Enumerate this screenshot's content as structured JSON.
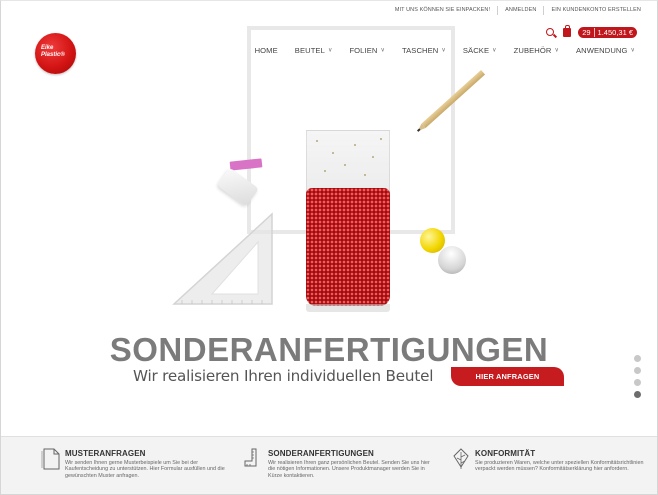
{
  "topbar": {
    "links": [
      "MIT UNS KÖNNEN SIE EINPACKEN!",
      "ANMELDEN",
      "EIN KUNDENKONTO ERSTELLEN"
    ]
  },
  "logo": {
    "text_line1": "Eike",
    "text_line2": "Plastic®",
    "icon": "logo-icon"
  },
  "cart": {
    "count": "29",
    "total": "1.450,31 €",
    "search_icon": "search-icon",
    "bag_icon": "shopping-bag-icon"
  },
  "nav": {
    "items": [
      {
        "label": "HOME",
        "dropdown": false
      },
      {
        "label": "BEUTEL",
        "dropdown": true
      },
      {
        "label": "FOLIEN",
        "dropdown": true
      },
      {
        "label": "TASCHEN",
        "dropdown": true
      },
      {
        "label": "SÄCKE",
        "dropdown": true
      },
      {
        "label": "ZUBEHÖR",
        "dropdown": true
      },
      {
        "label": "ANWENDUNG",
        "dropdown": true
      }
    ]
  },
  "hero": {
    "headline": "SONDERANFERTIGUNGEN",
    "subline": "Wir realisieren Ihren individuellen Beutel",
    "cta": "HIER ANFRAGEN",
    "slides": 4,
    "active_slide": 4
  },
  "features": [
    {
      "icon": "document-icon",
      "title": "MUSTERANFRAGEN",
      "text": "Wir senden Ihnen gerne Musterbeispiele um Sie bei der Kaufentscheidung zu unterstützen. Hier Formular ausfüllen und die gewünschten Muster anfragen."
    },
    {
      "icon": "measure-icon",
      "title": "SONDERANFERTIGUNGEN",
      "text": "Wir realisieren Ihren ganz persönlichen Beutel. Senden Sie uns hier die nötigen Informationen. Unsere Produktmanager werden Sie in Kürze kontaktieren."
    },
    {
      "icon": "leaf-icon",
      "title": "KONFORMITÄT",
      "text": "Sie produzieren Waren, welche unter speziellen Konformitätsrichtlinien verpackt werden müssen? Konformitätserklärung hier anfordern."
    }
  ],
  "colors": {
    "accent": "#c61b1f",
    "headline": "#7b7b7b",
    "strip": "#f3f3f3"
  }
}
